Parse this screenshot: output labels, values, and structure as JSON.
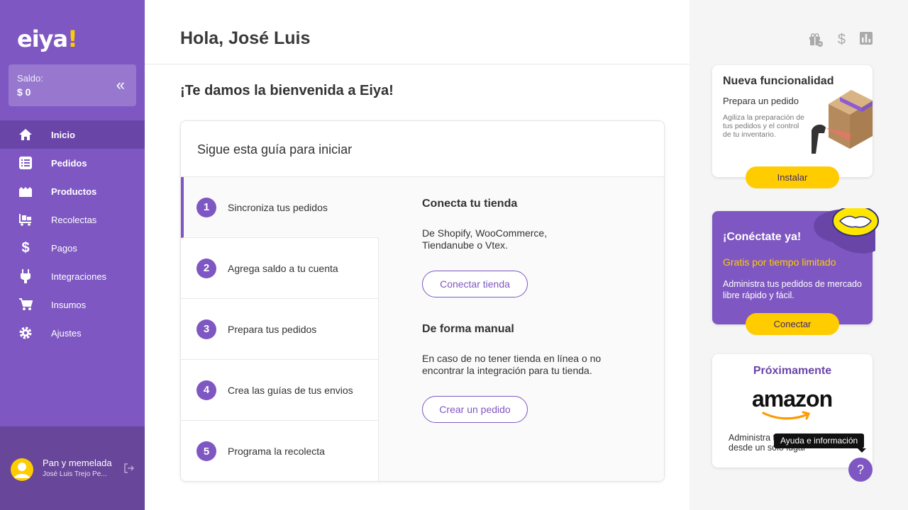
{
  "brand": {
    "logo_text": "eiya",
    "logo_mark": "!",
    "accent": "#7e57c2",
    "yellow": "#ffcc00"
  },
  "balance": {
    "label": "Saldo:",
    "value": "$ 0"
  },
  "nav": [
    {
      "label": "Inicio",
      "icon": "home-icon",
      "active": true
    },
    {
      "label": "Pedidos",
      "icon": "list-icon"
    },
    {
      "label": "Productos",
      "icon": "boxes-icon"
    },
    {
      "label": "Recolectas",
      "icon": "dolly-icon"
    },
    {
      "label": "Pagos",
      "icon": "dollar-icon"
    },
    {
      "label": "Integraciones",
      "icon": "plug-icon"
    },
    {
      "label": "Insumos",
      "icon": "cart-icon"
    },
    {
      "label": "Ajustes",
      "icon": "gear-icon"
    }
  ],
  "user": {
    "shop": "Pan y memelada",
    "name": "José Luis Trejo Pe..."
  },
  "header": {
    "greeting": "Hola, José Luis"
  },
  "main": {
    "welcome": "¡Te damos la bienvenida a Eiya!",
    "guide_title": "Sigue esta guía para iniciar",
    "steps": [
      {
        "num": "1",
        "label": "Sincroniza tus pedidos"
      },
      {
        "num": "2",
        "label": "Agrega saldo a tu cuenta"
      },
      {
        "num": "3",
        "label": "Prepara tus pedidos"
      },
      {
        "num": "4",
        "label": "Crea las guías de tus envios"
      },
      {
        "num": "5",
        "label": "Programa la recolecta"
      }
    ],
    "content": {
      "h1": "Conecta tu tienda",
      "p1": "De Shopify, WooCommerce, Tiendanube o Vtex.",
      "btn1": "Conectar tienda",
      "h2": "De forma manual",
      "p2": "En caso de no tener tienda en línea o no encontrar la integración para tu tienda.",
      "btn2": "Crear un pedido"
    }
  },
  "right": {
    "card1": {
      "title": "Nueva funcionalidad",
      "subtitle": "Prepara un pedido",
      "desc": "Agiliza la preparación de tus pedidos y el control de tu inventario.",
      "button": "Instalar"
    },
    "card2": {
      "title": "¡Conéctate ya!",
      "subtitle": "Gratis por tiempo limitado",
      "desc": "Administra tus pedidos de mercado libre rápido y fácil.",
      "button": "Conectar"
    },
    "card3": {
      "title": "Próximamente",
      "logo": "amazon",
      "desc": "Administra tus canales de venta desde un solo lugar"
    },
    "tooltip": "Ayuda e información",
    "help": "?"
  }
}
